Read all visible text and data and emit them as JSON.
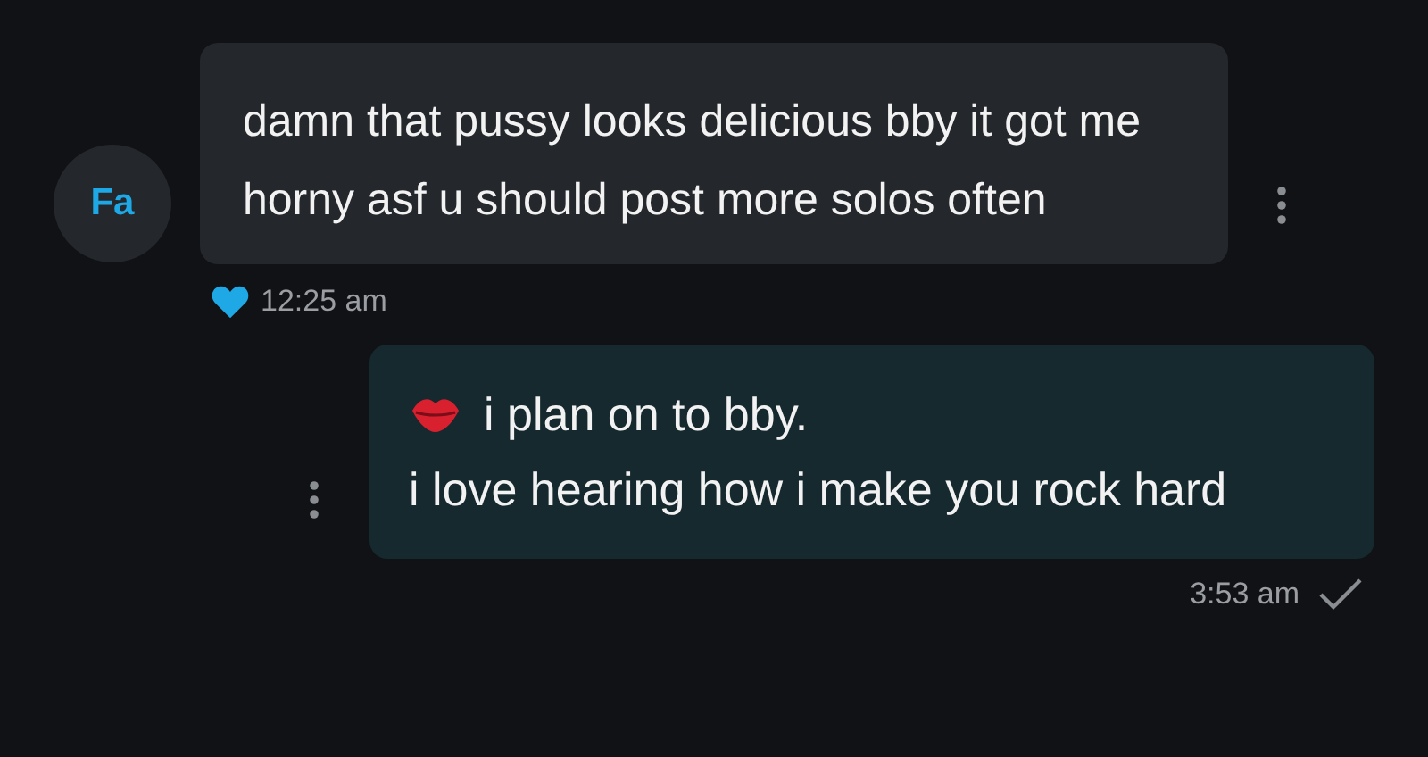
{
  "messages": [
    {
      "kind": "incoming",
      "avatar": "Fa",
      "text": "damn that pussy looks delicious bby it got me horny asf u should post more solos often",
      "liked": true,
      "time": "12:25 am"
    },
    {
      "kind": "outgoing",
      "lines": [
        {
          "kiss": true,
          "text": "i plan on to bby."
        },
        {
          "kiss": false,
          "text": "i love hearing how i make you rock hard"
        }
      ],
      "time": "3:53 am",
      "read": true
    }
  ]
}
